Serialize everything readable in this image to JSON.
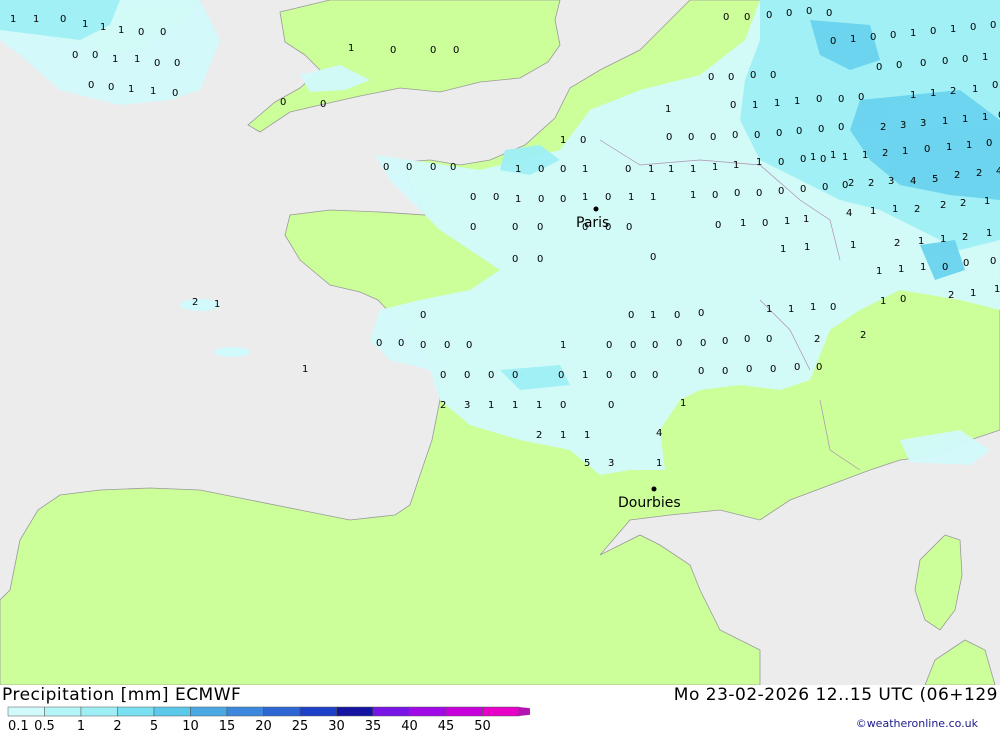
{
  "map": {
    "colors": {
      "sea": "#ececec",
      "land": "#ccff99",
      "precip_light": "#d2fafc",
      "precip_mid": "#9eeff5",
      "precip_high": "#6ad3ee"
    },
    "cities": [
      {
        "name": "Paris",
        "label": "Paris"
      },
      {
        "name": "Dourbies",
        "label": "Dourbies"
      }
    ],
    "value_labels": [
      "1",
      "1",
      "0",
      "1",
      "1",
      "1",
      "0",
      "0",
      "0",
      "0",
      "1",
      "1",
      "0",
      "0",
      "0",
      "0",
      "1",
      "1",
      "0",
      "1",
      "0",
      "0",
      "0",
      "0",
      "0",
      "1",
      "0",
      "0",
      "0",
      "0",
      "0",
      "1",
      "0",
      "0",
      "1",
      "0",
      "0",
      "1",
      "0",
      "0",
      "1",
      "0",
      "1",
      "1",
      "0",
      "0",
      "0",
      "0",
      "0",
      "0",
      "0",
      "0",
      "0",
      "0",
      "1",
      "1",
      "1",
      "1",
      "1",
      "1",
      "0",
      "0",
      "0",
      "1",
      "1",
      "1",
      "0",
      "0",
      "0",
      "0",
      "0",
      "0",
      "0",
      "0",
      "1",
      "0",
      "1",
      "1",
      "0",
      "0",
      "0",
      "0",
      "0",
      "0",
      "0",
      "0",
      "0",
      "1",
      "0",
      "0",
      "0",
      "0",
      "0",
      "1",
      "1",
      "1",
      "0",
      "0",
      "0",
      "0",
      "0",
      "0",
      "0",
      "0",
      "0",
      "0",
      "1",
      "0",
      "0",
      "0",
      "0",
      "0",
      "0",
      "0",
      "1",
      "0",
      "0",
      "0",
      "0",
      "0",
      "0",
      "0",
      "0",
      "0",
      "0",
      "0",
      "0",
      "0",
      "1",
      "0",
      "0",
      "0",
      "0",
      "0",
      "0",
      "0",
      "0",
      "0",
      "2",
      "3",
      "1",
      "1",
      "1",
      "0",
      "0",
      "1",
      "2",
      "1",
      "1",
      "4",
      "5",
      "3",
      "1",
      "1",
      "2",
      "1",
      "1",
      "1",
      "1",
      "0",
      "2",
      "2",
      "1",
      "1",
      "1",
      "1",
      "1",
      "1",
      "0",
      "0",
      "0",
      "1",
      "0",
      "2",
      "1",
      "1",
      "2",
      "1",
      "1",
      "2",
      "1",
      "4",
      "1",
      "1",
      "2",
      "2",
      "2",
      "1",
      "1",
      "1",
      "2",
      "2",
      "3",
      "4",
      "5",
      "2",
      "2",
      "4",
      "2",
      "3",
      "3",
      "1",
      "1",
      "1",
      "0",
      "2",
      "1",
      "0",
      "1",
      "1",
      "0",
      "1",
      "1",
      "2",
      "1",
      "0",
      "0",
      "0",
      "0",
      "0",
      "0",
      "1",
      "0",
      "1",
      "0",
      "0",
      "1",
      "0",
      "1",
      "0",
      "0",
      "0"
    ]
  },
  "header": {
    "title_left": "Precipitation [mm] ECMWF",
    "title_right": "Mo 23-02-2026 12..15 UTC (06+129"
  },
  "legend": {
    "ticks": [
      "0.1",
      "0.5",
      "1",
      "2",
      "5",
      "10",
      "15",
      "20",
      "25",
      "30",
      "35",
      "40",
      "45",
      "50"
    ],
    "colors": [
      "#d2fafc",
      "#b4f5f8",
      "#9eeff5",
      "#78e0f0",
      "#5cc8ea",
      "#4aa8e4",
      "#3c88dc",
      "#2d66d2",
      "#1e3fc8",
      "#1414a0",
      "#7814e6",
      "#a00ae6",
      "#c800dc",
      "#e600c8",
      "#b414b4"
    ]
  },
  "credit": "©weatheronline.co.uk"
}
